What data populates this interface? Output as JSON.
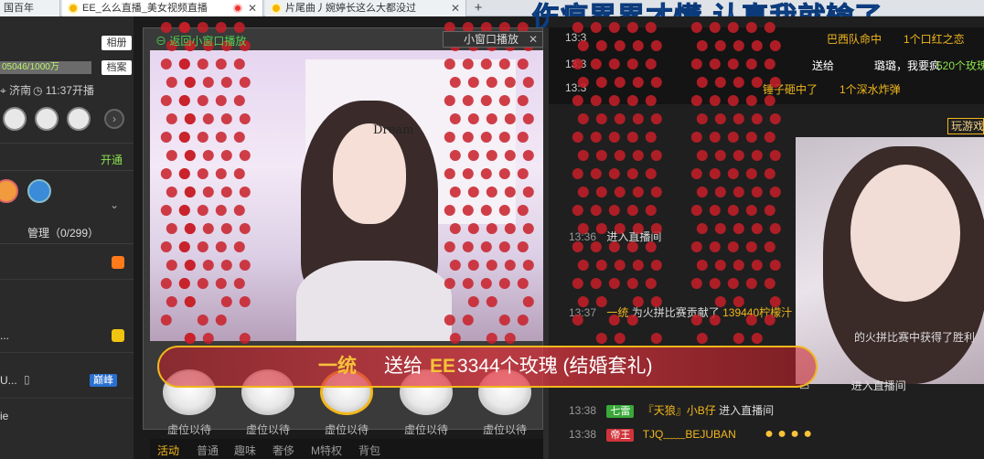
{
  "browser": {
    "tabs": [
      {
        "label": "国百年"
      },
      {
        "label": "EE_么么直播_美女视频直播"
      },
      {
        "label": "片尾曲丿婉婷长这么大都没过"
      }
    ],
    "new_tab": "+"
  },
  "banner_text": "伤痕累累才懂 认真我就输了",
  "left_panel": {
    "follow_btn": "相册",
    "archive_btn": "档案",
    "fans": "05046/1000万",
    "location": "济南",
    "live_time": "11:37开播",
    "open_label": "开通",
    "admin_tab": "管理（0/299）",
    "list_items": [
      {
        "name": "...",
        "badge": ""
      },
      {
        "name": "U...",
        "badge": "巅峰"
      },
      {
        "name": "ie",
        "badge": ""
      }
    ]
  },
  "video": {
    "back_link": "返回小窗口播放",
    "small_window": "小窗口播放",
    "dream_text": "Dream"
  },
  "gift_banner": {
    "sender": "一统",
    "send_to": "送给",
    "recipient": "EE",
    "gift": "3344个玫瑰 (结婚套礼)"
  },
  "gifts": [
    {
      "label": "虚位以待"
    },
    {
      "label": "虚位以待"
    },
    {
      "label": "虚位以待"
    },
    {
      "label": "虚位以待"
    },
    {
      "label": "虚位以待"
    }
  ],
  "bottom_tabs": [
    "活动",
    "普通",
    "趣味",
    "奢侈",
    "M特权",
    "背包"
  ],
  "ticker": [
    {
      "time": "13:3",
      "text": "巴西队命中",
      "gift": "1个口红之恋"
    },
    {
      "time": "13:3",
      "text": "送给",
      "user": "璐璐，我要疯",
      "gift": "520个玫瑰"
    },
    {
      "time": "13:3",
      "text": "锤子砸中了",
      "gift": "1个深水炸弹"
    }
  ],
  "play_game": "玩游戏",
  "chat": [
    {
      "time": "13:36",
      "text": "进入直播间"
    },
    {
      "time": "13:37",
      "user": "一统",
      "text": "为火拼比赛贡献了",
      "amount": "139440柠檬汁"
    },
    {
      "time": "",
      "text": "的火拼比赛中获得了胜利"
    },
    {
      "time": "",
      "text": "进入直播间"
    },
    {
      "time": "13:38",
      "badge": "七雷",
      "user": "『天狼』小B仔",
      "text": "进入直播间"
    },
    {
      "time": "13:38",
      "badge": "帝王",
      "user": "TJQ﹏﹏BEJUBAN",
      "text": ""
    }
  ],
  "colors": {
    "accent": "#f2b71c",
    "green": "#4fd14f",
    "banner_blue": "#1e63c6",
    "rose_red": "#c81e28"
  }
}
